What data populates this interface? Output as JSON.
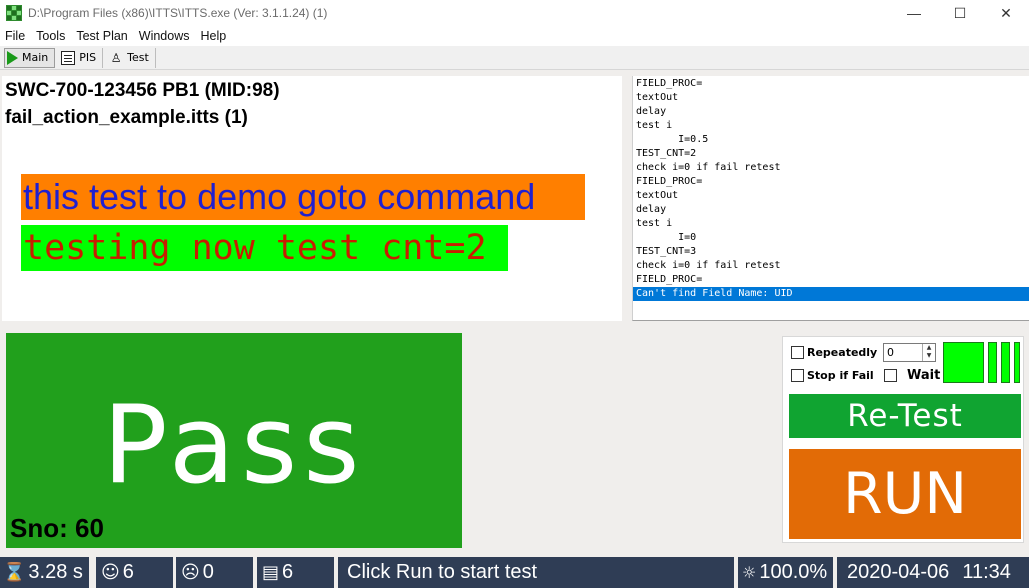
{
  "window": {
    "title": "D:\\Program Files (x86)\\ITTS\\ITTS.exe   (Ver: 3.1.1.24) (1)",
    "minimize_glyph": "—",
    "maximize_glyph": "☐",
    "close_glyph": "✕"
  },
  "menu": [
    "File",
    "Tools",
    "Test Plan",
    "Windows",
    "Help"
  ],
  "toolbar": {
    "main_label": "Main",
    "pis_label": "PIS",
    "test_label": "Test"
  },
  "info": {
    "line1": "SWC-700-123456 PB1 (MID:98)",
    "line2": "fail_action_example.itts  (1)",
    "message1": "this test to demo goto command",
    "message2": "testing now test cnt=2",
    "colors": {
      "message1_bg": "#ff7f00",
      "message1_fg": "#2020d0",
      "message2_bg": "#00ff00",
      "message2_fg": "#c81d00"
    }
  },
  "log": [
    "FIELD_PROC=",
    "textOut",
    "delay",
    "test i",
    "       I=0.5",
    "TEST_CNT=2",
    "check i=0 if fail retest",
    "FIELD_PROC=",
    "textOut",
    "delay",
    "test i",
    "       I=0",
    "TEST_CNT=3",
    "check i=0 if fail retest",
    "FIELD_PROC=",
    "Can't find Field Name: UID"
  ],
  "result": {
    "status": "Pass",
    "sno_label": "Sno: 60",
    "color": "#21a01c"
  },
  "controls": {
    "repeatedly_label": "Repeatedly",
    "repeatedly_checked": false,
    "stop_if_fail_label": "Stop if Fail",
    "stop_if_fail_checked": false,
    "count_value": "0",
    "wait_label": "Wait",
    "wait_checked": false,
    "retest_label": "Re-Test",
    "run_label": "RUN",
    "colors": {
      "retest": "#10a431",
      "run": "#e26b06",
      "indicator": "#00ff00"
    }
  },
  "status": {
    "time": "3.28 s",
    "pass_count": "6",
    "fail_count": "0",
    "total_count": "6",
    "message": "Click Run to start test",
    "percent": "100.0%",
    "date": "2020-04-06",
    "clock": "11:34"
  }
}
